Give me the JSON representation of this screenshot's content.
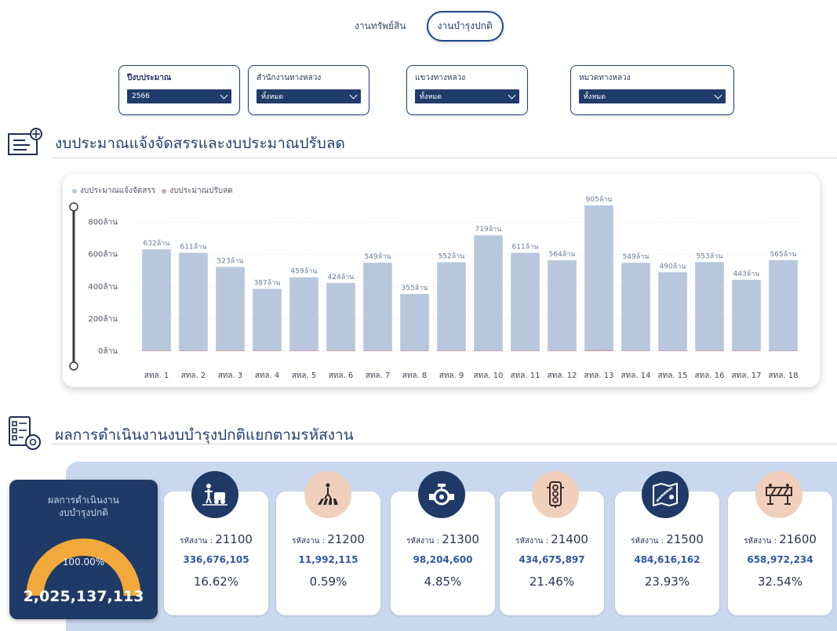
{
  "tabs": [
    {
      "label": "งานทรัพย์สิน",
      "active": false
    },
    {
      "label": "งานบำรุงปกติ",
      "active": true
    }
  ],
  "filters": [
    {
      "label": "ปีงบประมาณ",
      "value": "2566"
    },
    {
      "label": "สำนักงานทางหลวง",
      "value": "ทั้งหมด"
    },
    {
      "label": "แขวงทางหลวง",
      "value": "ทั้งหมด"
    },
    {
      "label": "หมวดทางหลวง",
      "value": "ทั้งหมด"
    }
  ],
  "budget_section": {
    "title": "งบประมาณแจ้งจัดสรรและงบประมาณปรับลด",
    "icon": "budget-document-icon"
  },
  "chart_data": {
    "type": "bar",
    "legend": [
      "งบประมาณแจ้งจัดสรร",
      "งบประมาณปรับลด"
    ],
    "legend_colors": [
      "#b9c7dd",
      "#c9a7b2"
    ],
    "categories": [
      "สทล. 1",
      "สทล. 2",
      "สทล. 3",
      "สทล. 4",
      "สทล. 5",
      "สทล. 6",
      "สทล. 7",
      "สทล. 8",
      "สทล. 9",
      "สทล. 10",
      "สทล. 11",
      "สทล. 12",
      "สทล. 13",
      "สทล. 14",
      "สทล. 15",
      "สทล. 16",
      "สทล. 17",
      "สทล. 18"
    ],
    "series": [
      {
        "name": "งบประมาณแจ้งจัดสรร",
        "values": [
          632,
          611,
          523,
          387,
          459,
          424,
          549,
          355,
          552,
          719,
          611,
          564,
          905,
          549,
          490,
          553,
          443,
          565
        ]
      },
      {
        "name": "งบประมาณปรับลด",
        "values": [
          5,
          2,
          1,
          2,
          2,
          1,
          2,
          1,
          2,
          1,
          2,
          2,
          8,
          2,
          2,
          2,
          1,
          2
        ]
      }
    ],
    "data_labels": [
      "632ล้าน",
      "611ล้าน",
      "523ล้าน",
      "387ล้าน",
      "459ล้าน",
      "424ล้าน",
      "549ล้าน",
      "355ล้าน",
      "552ล้าน",
      "719ล้าน",
      "611ล้าน",
      "564ล้าน",
      "905ล้าน",
      "549ล้าน",
      "490ล้าน",
      "553ล้าน",
      "443ล้าน",
      "565ล้าน"
    ],
    "y_ticks": [
      "0ล้าน",
      "200ล้าน",
      "400ล้าน",
      "600ล้าน",
      "800ล้าน"
    ],
    "y_tick_values": [
      0,
      200,
      400,
      600,
      800
    ],
    "ylim": [
      0,
      905
    ],
    "grid": true
  },
  "results_section": {
    "title": "ผลการดำเนินงานงบบำรุงปกติแยกตามรหัสงาน",
    "icon": "results-checklist-icon"
  },
  "total": {
    "title1": "ผลการดำเนินงาน",
    "title2": "งบบำรุงปกติ",
    "percent": "100.00%",
    "percent_value": 100,
    "value": "2,025,137,113"
  },
  "cards": [
    {
      "code_label": "รหัสงาน : ",
      "code": "21100",
      "amount": "336,676,105",
      "percent": "16.62%",
      "icon": "worker-vehicle-icon",
      "icon_style": "navy"
    },
    {
      "code_label": "รหัสงาน : ",
      "code": "21200",
      "amount": "11,992,115",
      "percent": "0.59%",
      "icon": "pedestrian-crossing-icon",
      "icon_style": "peach"
    },
    {
      "code_label": "รหัสงาน : ",
      "code": "21300",
      "amount": "98,204,600",
      "percent": "4.85%",
      "icon": "valve-icon",
      "icon_style": "navy"
    },
    {
      "code_label": "รหัสงาน : ",
      "code": "21400",
      "amount": "434,675,897",
      "percent": "21.46%",
      "icon": "traffic-light-icon",
      "icon_style": "peach"
    },
    {
      "code_label": "รหัสงาน : ",
      "code": "21500",
      "amount": "484,616,162",
      "percent": "23.93%",
      "icon": "road-map-icon",
      "icon_style": "navy"
    },
    {
      "code_label": "รหัสงาน : ",
      "code": "21600",
      "amount": "658,972,234",
      "percent": "32.54%",
      "icon": "road-barrier-icon",
      "icon_style": "peach"
    }
  ]
}
